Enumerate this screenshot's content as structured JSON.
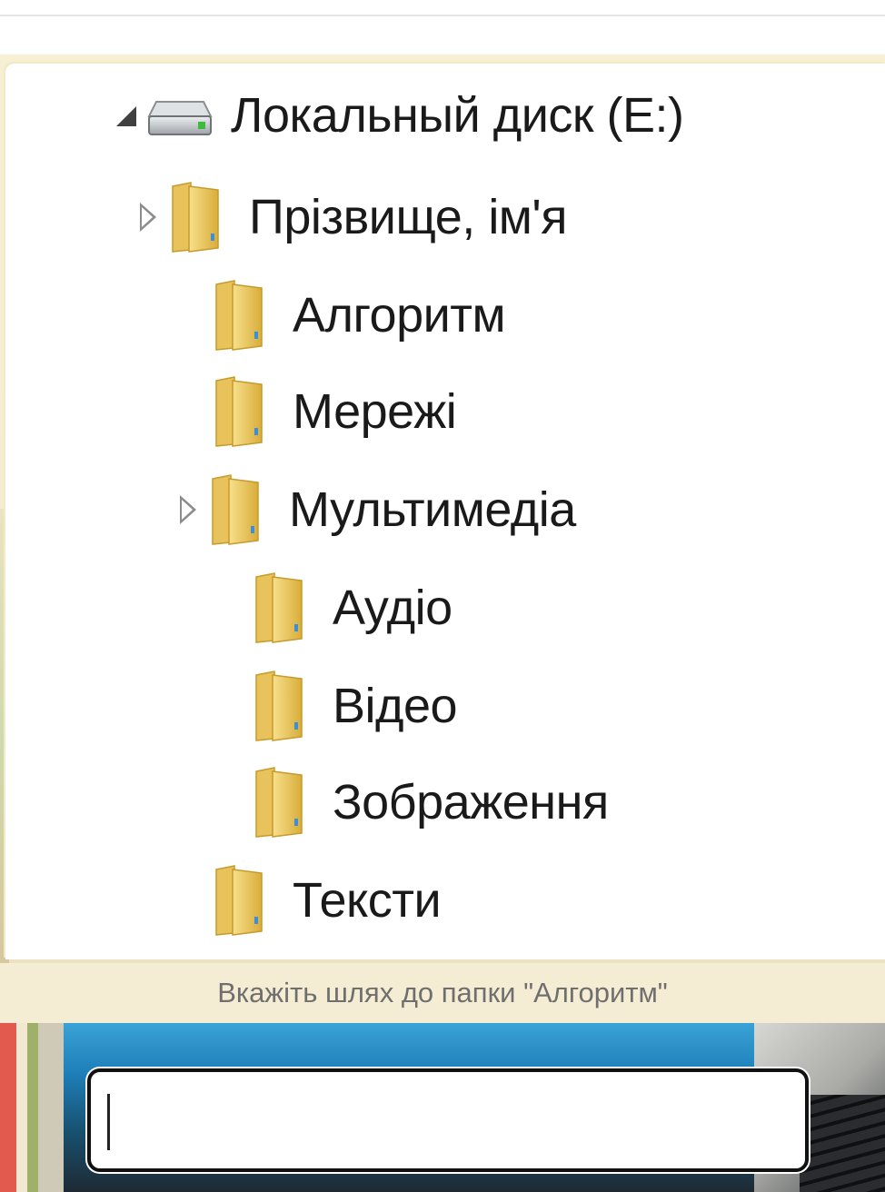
{
  "tree": {
    "items": [
      {
        "label": "Локальный диск (E:)",
        "type": "drive",
        "expander": "expanded"
      },
      {
        "label": "Прізвище, ім'я",
        "type": "folder",
        "expander": "collapsed"
      },
      {
        "label": "Алгоритм",
        "type": "folder",
        "expander": "none"
      },
      {
        "label": "Мережі",
        "type": "folder",
        "expander": "none"
      },
      {
        "label": "Мультимедіа",
        "type": "folder",
        "expander": "collapsed"
      },
      {
        "label": "Аудіо",
        "type": "folder",
        "expander": "none"
      },
      {
        "label": "Відео",
        "type": "folder",
        "expander": "none"
      },
      {
        "label": "Зображення",
        "type": "folder",
        "expander": "none"
      },
      {
        "label": "Тексти",
        "type": "folder",
        "expander": "none"
      }
    ]
  },
  "question": {
    "caption": "Вкажіть шлях до папки \"Алгоритм\""
  },
  "answer": {
    "value": "",
    "placeholder": ""
  },
  "colors": {
    "folder": "#e9c45a",
    "drive": "#c9ccd0",
    "caption_text": "#6f6f6f"
  }
}
